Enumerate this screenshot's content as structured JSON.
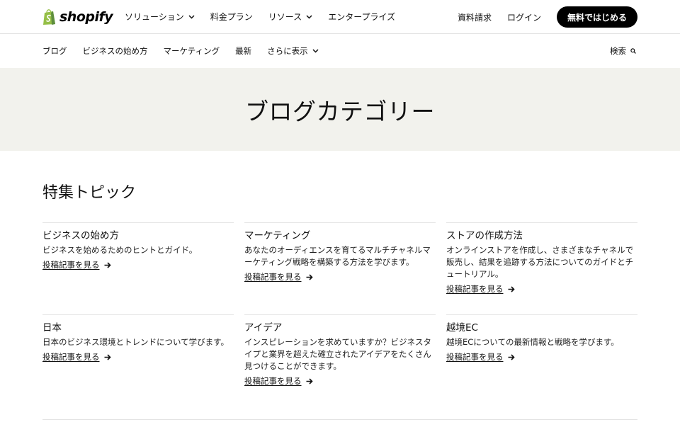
{
  "brand": {
    "name": "shopify",
    "color": "#95bf47"
  },
  "header": {
    "nav": [
      {
        "label": "ソリューション",
        "has_dropdown": true
      },
      {
        "label": "料金プラン",
        "has_dropdown": false
      },
      {
        "label": "リソース",
        "has_dropdown": true
      },
      {
        "label": "エンタープライズ",
        "has_dropdown": false
      }
    ],
    "request_docs": "資料請求",
    "login": "ログイン",
    "cta": "無料ではじめる"
  },
  "subnav": {
    "items": [
      {
        "label": "ブログ",
        "has_dropdown": false
      },
      {
        "label": "ビジネスの始め方",
        "has_dropdown": false
      },
      {
        "label": "マーケティング",
        "has_dropdown": false
      },
      {
        "label": "最新",
        "has_dropdown": false
      },
      {
        "label": "さらに表示",
        "has_dropdown": true
      }
    ],
    "search_label": "検索",
    "search_icon": "search-icon"
  },
  "hero": {
    "title": "ブログカテゴリー"
  },
  "featured": {
    "title": "特集トピック",
    "cards": [
      {
        "title": "ビジネスの始め方",
        "description": "ビジネスを始めるためのヒントとガイド。",
        "link": "投稿記事を見る"
      },
      {
        "title": "マーケティング",
        "description": "あなたのオーディエンスを育てるマルチチャネルマーケティング戦略を構築する方法を学びます。",
        "link": "投稿記事を見る"
      },
      {
        "title": "ストアの作成方法",
        "description": "オンラインストアを作成し、さまざまなチャネルで販売し、結果を追跡する方法についてのガイドとチュートリアル。",
        "link": "投稿記事を見る"
      },
      {
        "title": "日本",
        "description": "日本のビジネス環境とトレンドについて学びます。",
        "link": "投稿記事を見る"
      },
      {
        "title": "アイデア",
        "description": "インスピレーションを求めていますか？ビジネスタイプと業界を超えた確立されたアイデアをたくさん見つけることができます。",
        "link": "投稿記事を見る"
      },
      {
        "title": "越境EC",
        "description": "越境ECについての最新情報と戦略を学びます。",
        "link": "投稿記事を見る"
      }
    ]
  }
}
